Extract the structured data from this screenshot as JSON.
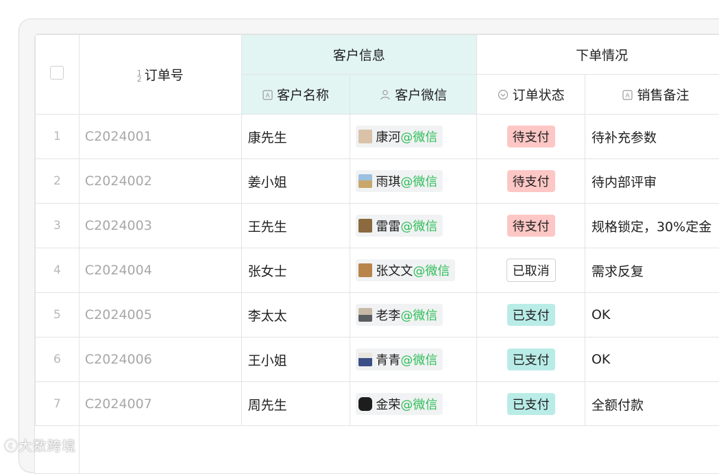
{
  "header": {
    "order_col": "订单号",
    "group_customer": "客户信息",
    "group_order": "下单情况",
    "col_customer_name": "客户名称",
    "col_customer_wechat": "客户微信",
    "col_order_status": "订单状态",
    "col_sales_note": "销售备注"
  },
  "rows": [
    {
      "idx": "1",
      "order": "C2024001",
      "name": "康先生",
      "wechat": "康河",
      "wx_suffix": "@微信",
      "status": "待支付",
      "status_type": "red",
      "note": "待补充参数",
      "avatar_color": "#d9c2a8"
    },
    {
      "idx": "2",
      "order": "C2024002",
      "name": "姜小姐",
      "wechat": "雨琪",
      "wx_suffix": "@微信",
      "status": "待支付",
      "status_type": "red",
      "note": "待内部评审",
      "avatar_color": "#9cb6cc"
    },
    {
      "idx": "3",
      "order": "C2024003",
      "name": "王先生",
      "wechat": "雷雷",
      "wx_suffix": "@微信",
      "status": "待支付",
      "status_type": "red",
      "note": "规格锁定，30%定金",
      "avatar_color": "#8a6a3e"
    },
    {
      "idx": "4",
      "order": "C2024004",
      "name": "张女士",
      "wechat": "张文文",
      "wx_suffix": "@微信",
      "status": "已取消",
      "status_type": "outline",
      "note": "需求反复",
      "avatar_color": "#b8844a"
    },
    {
      "idx": "5",
      "order": "C2024005",
      "name": "李太太",
      "wechat": "老李",
      "wx_suffix": "@微信",
      "status": "已支付",
      "status_type": "teal",
      "note": "OK",
      "avatar_color": "#7f8f9c"
    },
    {
      "idx": "6",
      "order": "C2024006",
      "name": "王小姐",
      "wechat": "青青",
      "wx_suffix": "@微信",
      "status": "已支付",
      "status_type": "teal",
      "note": "OK",
      "avatar_color": "#6a84b8"
    },
    {
      "idx": "7",
      "order": "C2024007",
      "name": "周先生",
      "wechat": "金荣",
      "wx_suffix": "@微信",
      "status": "已支付",
      "status_type": "teal",
      "note": "全额付款",
      "avatar_color": "#1d1d1d"
    }
  ],
  "watermark": "大数跨境",
  "colors": {
    "wechat_green": "#2fbf5a",
    "tag_red": "#fdc7c5",
    "tag_teal": "#b9ece7",
    "header_group": "#e2f5f2"
  }
}
